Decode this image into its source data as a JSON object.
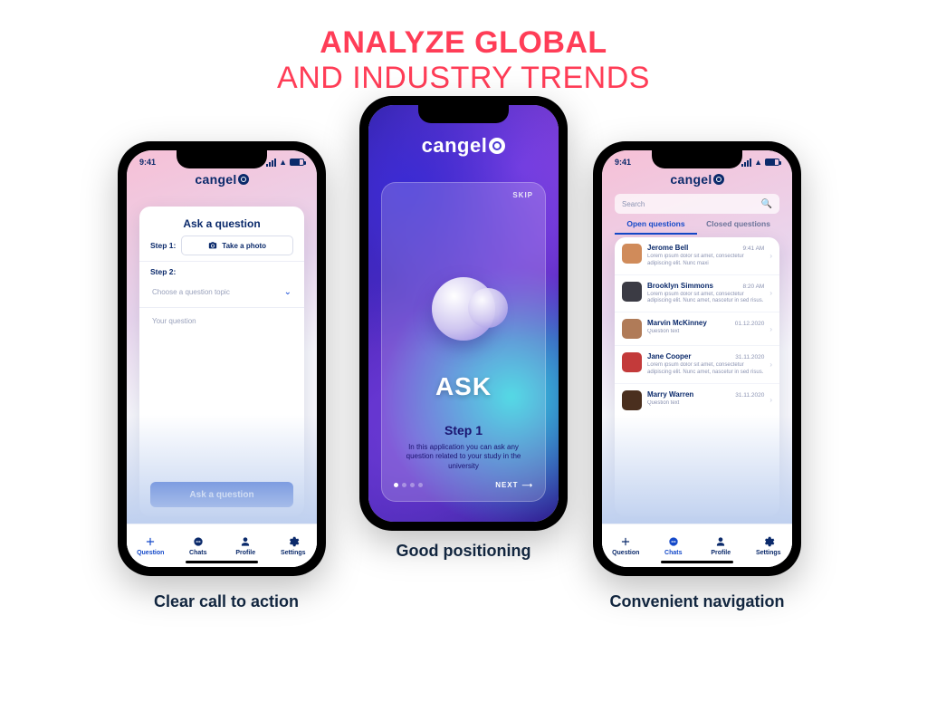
{
  "headline": {
    "line1": "ANALYZE GLOBAL",
    "line2": "AND INDUSTRY TRENDS"
  },
  "captions": {
    "left": "Clear call to action",
    "mid": "Good positioning",
    "right": "Convenient navigation"
  },
  "brand": "cangel",
  "status": {
    "time": "9:41"
  },
  "tabs": [
    {
      "key": "question",
      "label": "Question"
    },
    {
      "key": "chats",
      "label": "Chats"
    },
    {
      "key": "profile",
      "label": "Profile"
    },
    {
      "key": "settings",
      "label": "Settings"
    }
  ],
  "left": {
    "title": "Ask a question",
    "step1_label": "Step 1:",
    "take_photo": "Take a photo",
    "step2_label": "Step 2:",
    "topic_placeholder": "Choose a question topic",
    "question_placeholder": "Your question",
    "submit": "Ask a question",
    "active_tab": "question"
  },
  "mid": {
    "skip": "SKIP",
    "ask": "ASK",
    "step_title": "Step 1",
    "step_desc": "In this application you can ask any question related to your study in the university",
    "next": "NEXT",
    "page_index": 0,
    "page_count": 4
  },
  "right": {
    "search_placeholder": "Search",
    "seg_open": "Open questions",
    "seg_closed": "Closed questions",
    "active_tab": "chats",
    "items": [
      {
        "name": "Jerome Bell",
        "time": "9:41 AM",
        "sub": "Lorem ipsum dolor sit amet, consectetur adipiscing elit. Nunc maxi",
        "avatar": "#d08b5a"
      },
      {
        "name": "Brooklyn Simmons",
        "time": "8:20 AM",
        "sub": "Lorem ipsum dolor sit amet, consectetur adipiscing elit. Nunc amet, nascetur in sed risus.",
        "avatar": "#3b3b44"
      },
      {
        "name": "Marvin McKinney",
        "time": "01.12.2020",
        "sub": "Question text",
        "avatar": "#b07b58"
      },
      {
        "name": "Jane Cooper",
        "time": "31.11.2020",
        "sub": "Lorem ipsum dolor sit amet, consectetur adipiscing elit. Nunc amet, nascetur in sed risus.",
        "avatar": "#c33a3a"
      },
      {
        "name": "Marry Warren",
        "time": "31.11.2020",
        "sub": "Question text",
        "avatar": "#4a2f1e"
      }
    ]
  },
  "colors": {
    "accent": "#ff3d57",
    "primary": "#1449c9",
    "navy": "#0b2a6b"
  }
}
